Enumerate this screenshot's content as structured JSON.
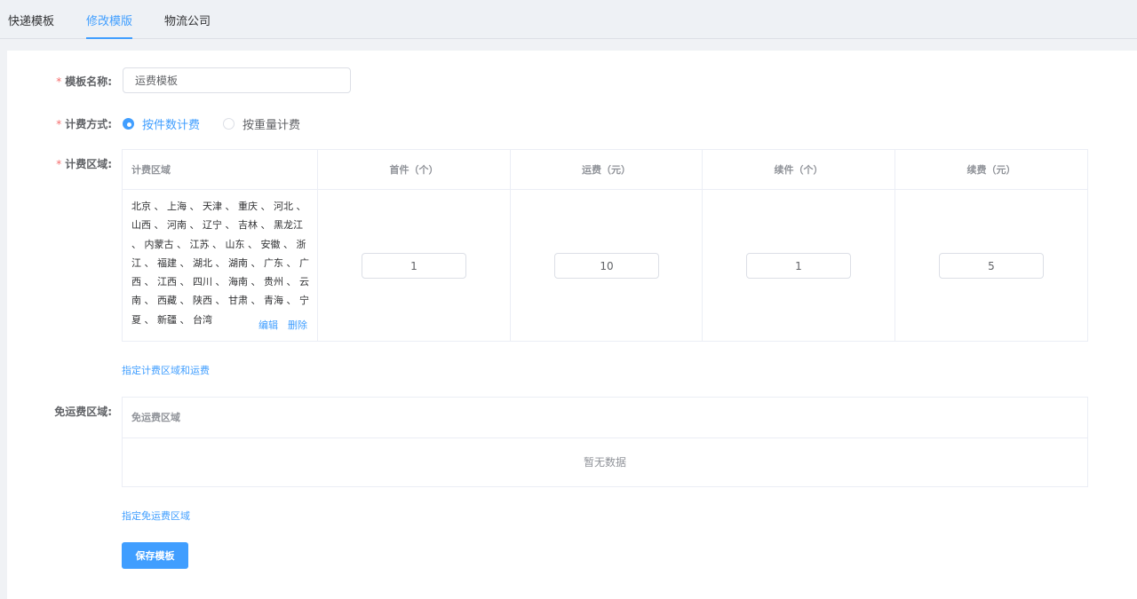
{
  "tabs": [
    {
      "label": "快递模板"
    },
    {
      "label": "修改模版"
    },
    {
      "label": "物流公司"
    }
  ],
  "active_tab": "修改模版",
  "form": {
    "required_mark": "*",
    "name_label": "模板名称:",
    "name_value": "运费模板",
    "method_label": "计费方式:",
    "method_options": [
      {
        "label": "按件数计费",
        "checked": true
      },
      {
        "label": "按重量计费",
        "checked": false
      }
    ],
    "area_label": "计费区域:",
    "free_label": "免运费区域:"
  },
  "fee_table": {
    "columns": [
      "计费区域",
      "首件（个）",
      "运费（元）",
      "续件（个）",
      "续费（元）"
    ],
    "row": {
      "regions": "北京 、 上海 、 天津 、 重庆 、 河北 、 山西 、 河南 、 辽宁 、 吉林 、 黑龙江 、 内蒙古 、 江苏 、 山东 、 安徽 、 浙江 、 福建 、 湖北 、 湖南 、 广东 、 广西 、 江西 、 四川 、 海南 、 贵州 、 云南 、 西藏 、 陕西 、 甘肃 、 青海 、 宁夏 、 新疆 、 台湾",
      "edit_label": "编辑",
      "delete_label": "删除",
      "first_count": "1",
      "fee": "10",
      "next_count": "1",
      "next_fee": "5"
    },
    "add_link": "指定计费区域和运费"
  },
  "free_table": {
    "header": "免运费区域",
    "empty_text": "暂无数据",
    "add_link": "指定免运费区域"
  },
  "save_label": "保存模板",
  "colors": {
    "primary": "#409eff",
    "required": "#f56c6c",
    "page_bg": "#f0f2f5"
  }
}
